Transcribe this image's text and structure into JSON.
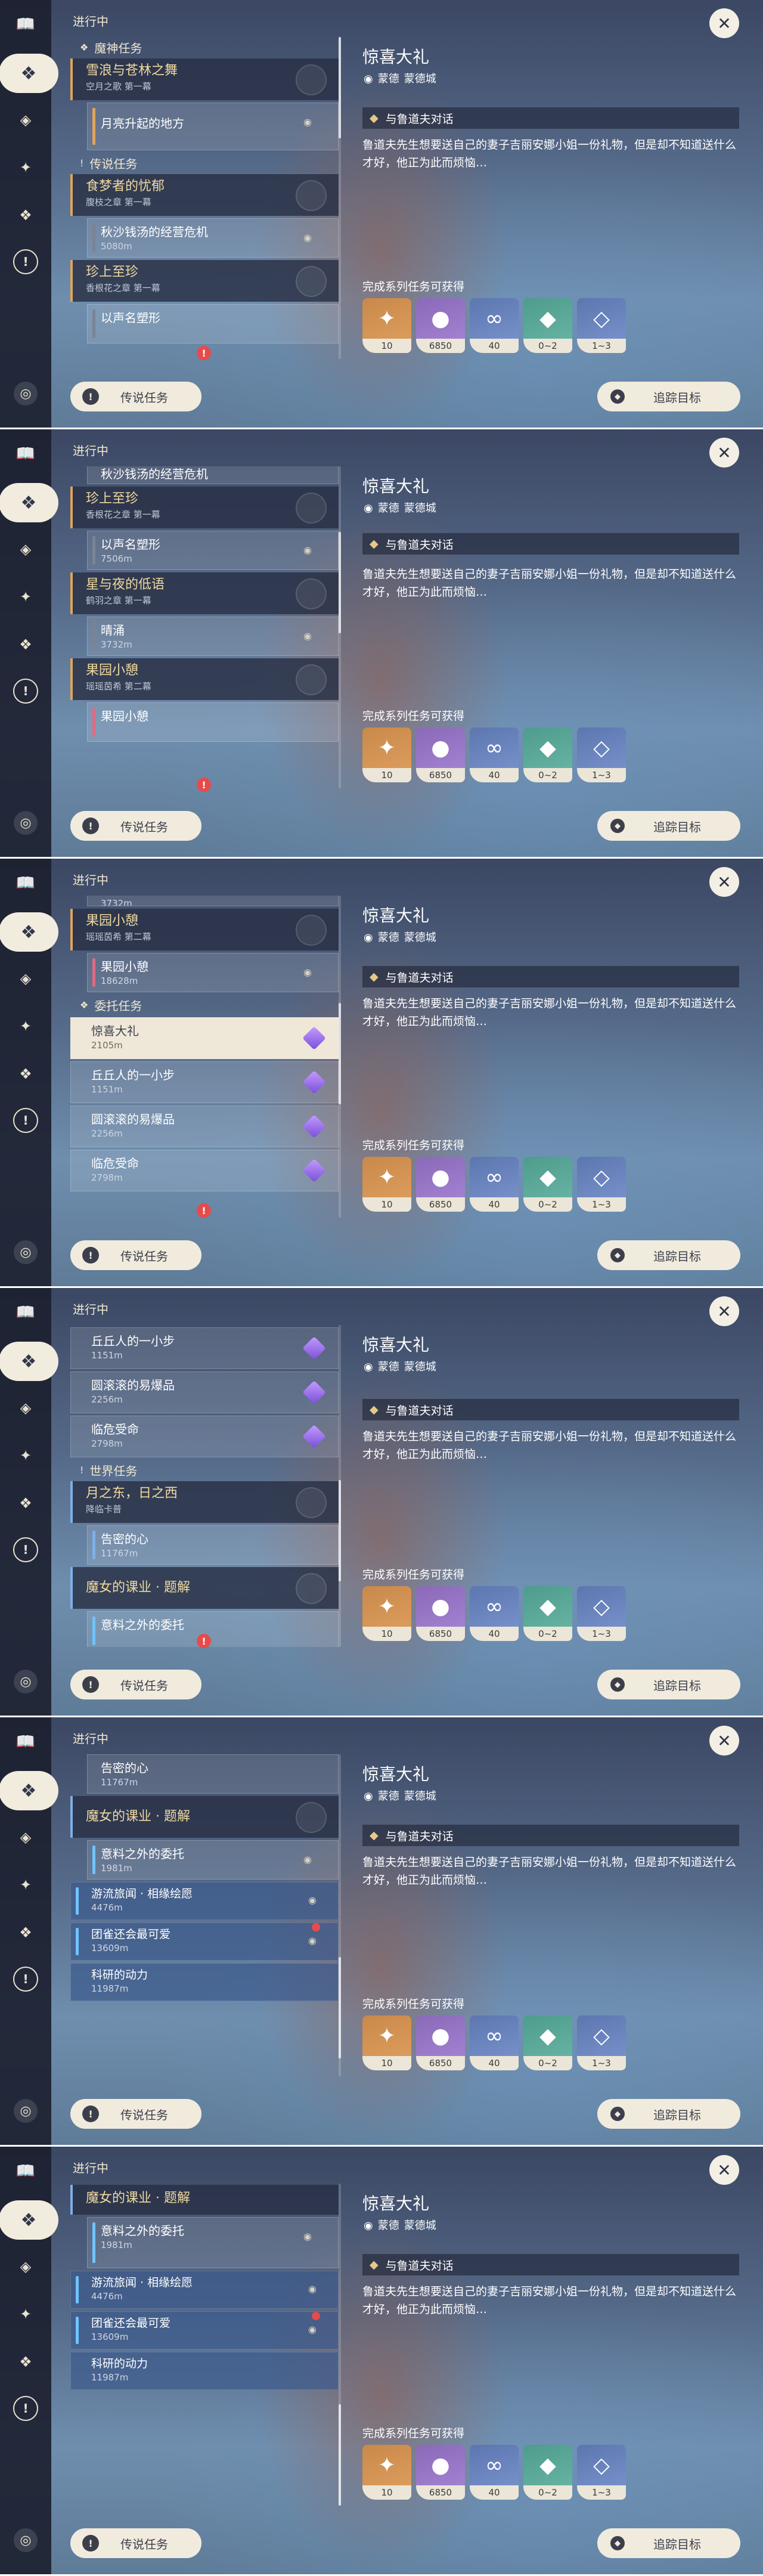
{
  "header": {
    "title": "进行中"
  },
  "categories": {
    "archon": "魔神任务",
    "legend": "传说任务",
    "commission": "委托任务",
    "world": "世界任务"
  },
  "quests": {
    "archon": {
      "name": "雪浪与苍林之舞",
      "sub": "空月之歌 第一幕"
    },
    "archon_step": {
      "name": "月亮升起的地方"
    },
    "legend1": {
      "name": "食梦者的忧郁",
      "sub": "腹枝之章 第一幕"
    },
    "legend1_step": {
      "name": "秋沙钱汤的经营危机",
      "dist": "5080m"
    },
    "legend2": {
      "name": "珍上至珍",
      "sub": "香根花之章 第一幕"
    },
    "legend2_step": {
      "name": "以声名塑形",
      "dist": "7506m"
    },
    "legend3": {
      "name": "星与夜的低语",
      "sub": "鹤羽之章 第一幕"
    },
    "legend3_step": {
      "name": "晴涌",
      "dist": "3732m"
    },
    "legend4": {
      "name": "果园小憩",
      "sub": "瑶瑶茵希 第二幕"
    },
    "legend4_step": {
      "name": "果园小憩",
      "dist": "18628m"
    },
    "world1": {
      "name": "月之东，日之西",
      "sub": "降临卡普"
    },
    "world1_step": {
      "name": "告密的心",
      "dist": "11767m"
    },
    "world2": {
      "name": "魔女的课业 · 题解"
    },
    "world2_step1": {
      "name": "意料之外的委托",
      "dist": "1981m"
    },
    "world2_step2": {
      "name": "游流旅闻 · 相缘绘愿",
      "dist": "4476m"
    },
    "world2_step3": {
      "name": "团雀还会最可爱",
      "dist": "13609m"
    },
    "world2_step4": {
      "name": "科研的动力",
      "dist": "11987m"
    }
  },
  "commissions": [
    {
      "name": "惊喜大礼",
      "dist": "2105m"
    },
    {
      "name": "丘丘人的一小步",
      "dist": "1151m"
    },
    {
      "name": "圆滚滚的易爆品",
      "dist": "2256m"
    },
    {
      "name": "临危受命",
      "dist": "2798m"
    }
  ],
  "legend_button": "传说任务",
  "detail": {
    "title": "惊喜大礼",
    "region": "蒙德",
    "city": "蒙德城",
    "objective": "与鲁道夫对话",
    "description": "鲁道夫先生想要送自己的妻子吉丽安娜小姐一份礼物，但是却不知道送什么才好，他正为此而烦恼…",
    "rewards_label": "完成系列任务可获得",
    "rewards": [
      {
        "icon": "primogem-icon",
        "count": "10"
      },
      {
        "icon": "mora-icon",
        "count": "6850"
      },
      {
        "icon": "exp-icon",
        "count": "40"
      },
      {
        "icon": "ore-icon",
        "count": "0~2"
      },
      {
        "icon": "crystal-icon",
        "count": "1~3"
      }
    ],
    "track_button": "追踪目标"
  },
  "scroll_positions": [
    0.0,
    0.3,
    0.5,
    0.7,
    0.9,
    1.0
  ]
}
